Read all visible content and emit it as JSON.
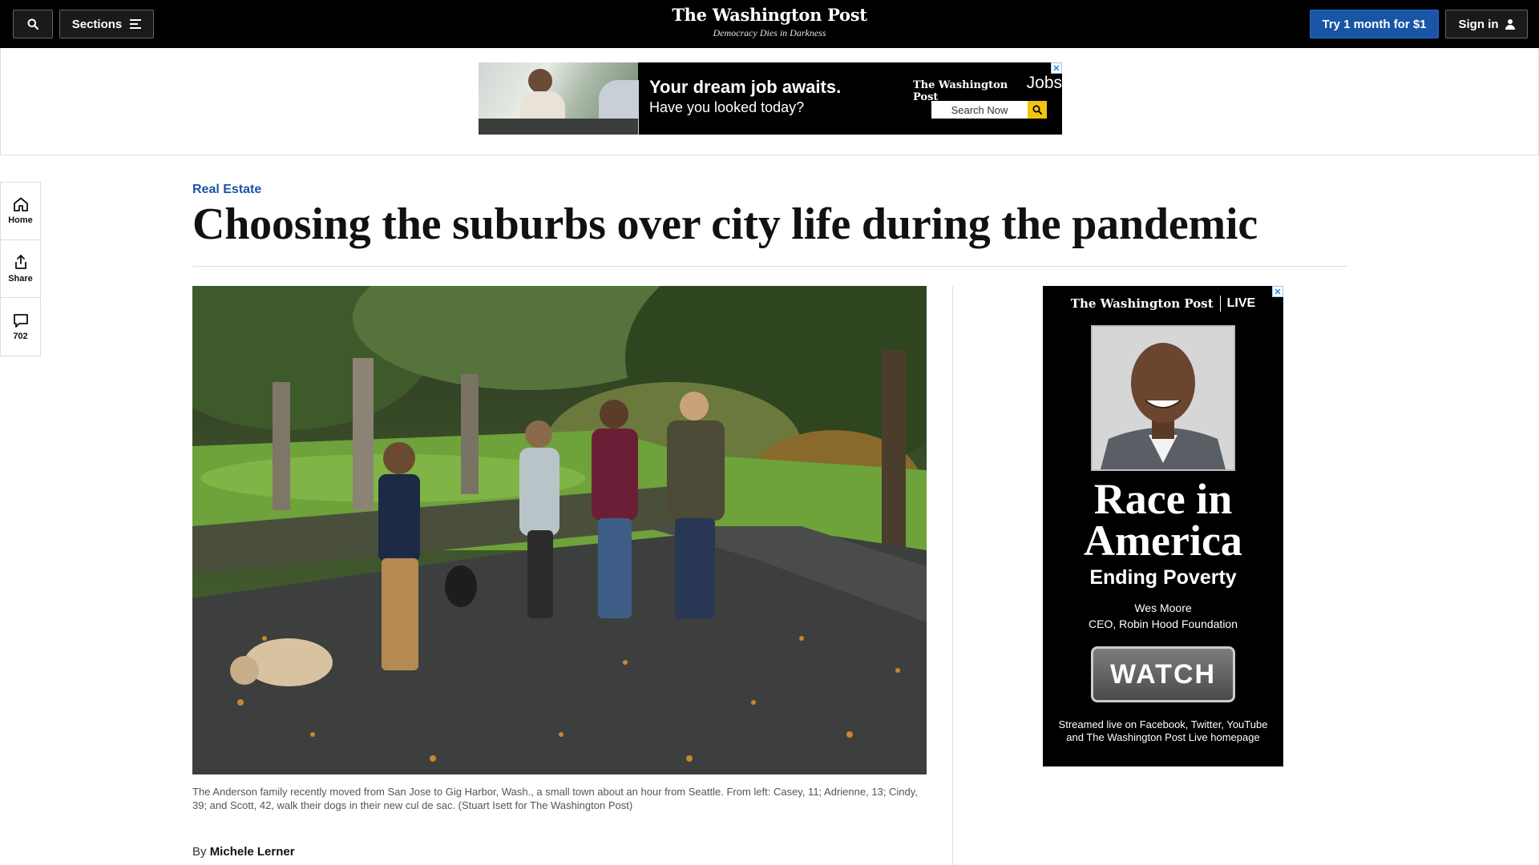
{
  "header": {
    "sections_label": "Sections",
    "logo": "The Washington Post",
    "tagline": "Democracy Dies in Darkness",
    "subscribe_label": "Try 1 month for $1",
    "signin_label": "Sign in"
  },
  "top_ad": {
    "headline": "Your dream job awaits.",
    "subhead": "Have you looked today?",
    "brand": "The Washington Post",
    "brand_suffix": "Jobs",
    "search_label": "Search Now",
    "close_label": "✕"
  },
  "rail": {
    "home_label": "Home",
    "share_label": "Share",
    "comments_count": "702"
  },
  "article": {
    "kicker": "Real Estate",
    "headline": "Choosing the suburbs over city life during the pandemic",
    "caption": "The Anderson family recently moved from San Jose to Gig Harbor, Wash., a small town about an hour from Seattle. From left: Casey, 11; Adrienne, 13; Cindy, 39; and Scott, 42, walk their dogs in their new cul de sac. (Stuart Isett for The Washington Post)",
    "byline_prefix": "By",
    "author": "Michele Lerner"
  },
  "side_ad": {
    "brand": "The Washington Post",
    "brand_suffix": "LIVE",
    "title_line1": "Race in",
    "title_line2": "America",
    "subtitle": "Ending Poverty",
    "speaker_name": "Wes Moore",
    "speaker_title": "CEO, Robin Hood Foundation",
    "cta": "WATCH",
    "footer_line1": "Streamed live on Facebook, Twitter, YouTube",
    "footer_line2": "and The Washington Post Live homepage",
    "close_label": "✕"
  },
  "colors": {
    "accent": "#1955a5",
    "topbar": "#000000",
    "rule": "#dddddd"
  }
}
